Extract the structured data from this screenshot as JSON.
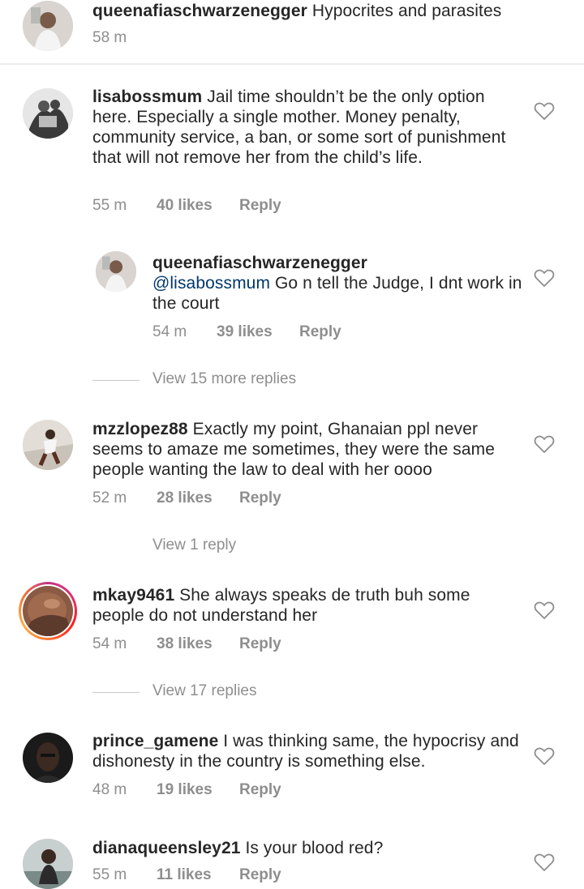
{
  "comments": [
    {
      "username": "queenafiaschwarzenegger",
      "text": " Hypocrites and parasites",
      "time": "58 m"
    },
    {
      "username": "lisabossmum",
      "text": " Jail time shouldn’t be the only option here. Especially a single mother. Money penalty, community service, a ban, or some sort of punishment that will not remove her from the child’s life.",
      "time": "55 m",
      "likes": "40 likes",
      "reply": "Reply"
    },
    {
      "username": "queenafiaschwarzenegger",
      "mention": "@lisabossmum",
      "text": " Go n tell the Judge, I dnt work in the court",
      "time": "54 m",
      "likes": "39 likes",
      "reply": "Reply"
    },
    {
      "username": "mzzlopez88",
      "text": " Exactly my point, Ghanaian ppl never seems to amaze me sometimes, they were the same people wanting the law to deal with her oooo",
      "time": "52 m",
      "likes": "28 likes",
      "reply": "Reply"
    },
    {
      "username": "mkay9461",
      "text": " She always speaks de truth buh some people do not understand her",
      "time": "54 m",
      "likes": "38 likes",
      "reply": "Reply"
    },
    {
      "username": "prince_gamene",
      "text": " I was thinking same, the hypocrisy and dishonesty in the country is something else.",
      "time": "48 m",
      "likes": "19 likes",
      "reply": "Reply"
    },
    {
      "username": "dianaqueensley21",
      "text": " Is your blood red?",
      "time": "55 m",
      "likes": "11 likes",
      "reply": "Reply"
    }
  ],
  "view_replies": [
    "View 15 more replies",
    "View 1 reply",
    "View 17 replies"
  ],
  "colors": {
    "text": "#262626",
    "meta": "#8e8e8e",
    "mention": "#00376b",
    "divider": "#ececec"
  },
  "icons": {
    "like": "heart-outline-icon"
  }
}
